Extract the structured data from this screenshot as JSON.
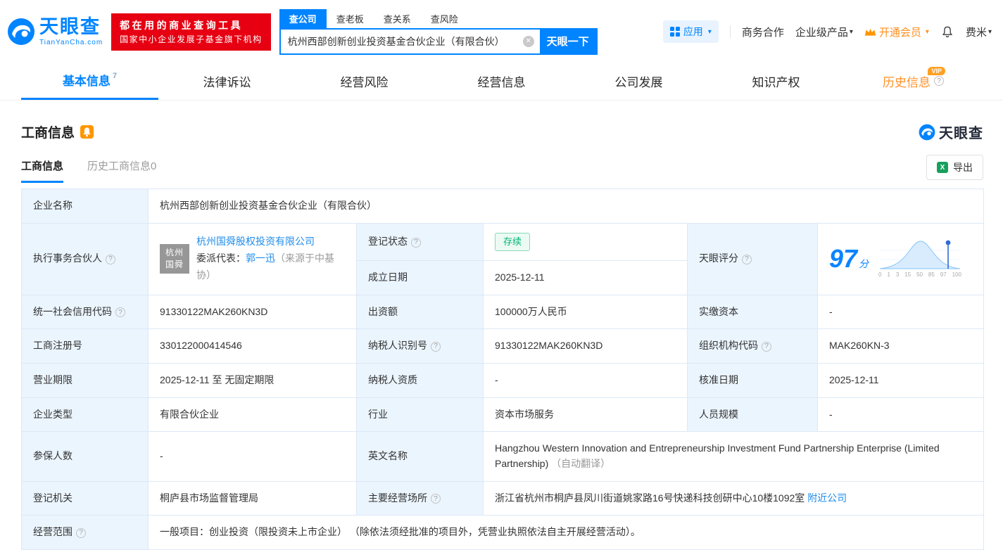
{
  "icons": {
    "caret": "▾",
    "help": "?",
    "clear": "✕",
    "excel": "X"
  },
  "header": {
    "logo_text": "天眼查",
    "logo_domain": "TianYanCha.com",
    "promo_line1": "都在用的商业查询工具",
    "promo_line2": "国家中小企业发展子基金旗下机构",
    "search_tabs": [
      {
        "label": "查公司"
      },
      {
        "label": "查老板"
      },
      {
        "label": "查关系"
      },
      {
        "label": "查风险"
      }
    ],
    "search_value": "杭州西部创新创业投资基金合伙企业（有限合伙）",
    "search_button": "天眼一下",
    "apps_label": "应用",
    "biz_coop": "商务合作",
    "enterprise_product": "企业级产品",
    "vip_label": "开通会员",
    "username": "费米"
  },
  "nav": {
    "tabs": [
      {
        "label": "基本信息",
        "count": "7"
      },
      {
        "label": "法律诉讼"
      },
      {
        "label": "经营风险"
      },
      {
        "label": "经营信息"
      },
      {
        "label": "公司发展"
      },
      {
        "label": "知识产权"
      },
      {
        "label": "历史信息",
        "vip": "VIP"
      }
    ]
  },
  "section": {
    "title": "工商信息",
    "watermark": "天眼查",
    "subtab_active": "工商信息",
    "subtab_history": "历史工商信息0",
    "export": "导出"
  },
  "table": {
    "company_name_label": "企业名称",
    "company_name": "杭州西部创新创业投资基金合伙企业（有限合伙）",
    "partner_label": "执行事务合伙人",
    "partner_logo": "杭州国舜",
    "partner_company": "杭州国舜股权投资有限公司",
    "delegate_prefix": "委派代表：",
    "delegate_name": "郭一迅",
    "delegate_source": "（来源于中基协）",
    "status_label": "登记状态",
    "status_value": "存续",
    "established_label": "成立日期",
    "established_value": "2025-12-11",
    "score_label": "天眼评分",
    "score_value": "97",
    "score_unit": "分",
    "score_axis": [
      "0",
      "1",
      "3",
      "15",
      "50",
      "85",
      "97",
      "100"
    ],
    "rows": [
      {
        "cells": [
          {
            "label": "统一社会信用代码",
            "value": "91330122MAK260KN3D"
          },
          {
            "label": "出资额",
            "value": "100000万人民币"
          },
          {
            "label": "实缴资本",
            "value": "-"
          }
        ]
      },
      {
        "cells": [
          {
            "label": "工商注册号",
            "value": "330122000414546"
          },
          {
            "label": "纳税人识别号",
            "value": "91330122MAK260KN3D"
          },
          {
            "label": "组织机构代码",
            "value": "MAK260KN-3"
          }
        ]
      },
      {
        "cells": [
          {
            "label": "营业期限",
            "value": "2025-12-11 至 无固定期限"
          },
          {
            "label": "纳税人资质",
            "value": "-"
          },
          {
            "label": "核准日期",
            "value": "2025-12-11"
          }
        ]
      },
      {
        "cells": [
          {
            "label": "企业类型",
            "value": "有限合伙企业"
          },
          {
            "label": "行业",
            "value": "资本市场服务"
          },
          {
            "label": "人员规模",
            "value": "-"
          }
        ]
      }
    ],
    "row7": {
      "label": "参保人数",
      "value": "-",
      "en_label": "英文名称",
      "en_value": "Hangzhou Western Innovation and Entrepreneurship Investment Fund Partnership Enterprise (Limited Partnership)",
      "en_note": "（自动翻译）"
    },
    "row8": {
      "label": "登记机关",
      "value": "桐庐县市场监督管理局",
      "addr_label": "主要经营场所",
      "addr_value": "浙江省杭州市桐庐县凤川街道姚家路16号快递科技创研中心10楼1092室",
      "nearby": "附近公司"
    },
    "row9": {
      "label": "经营范围",
      "value": "一般项目：创业投资（限投资未上市企业） （除依法须经批准的项目外，凭营业执照依法自主开展经营活动）。"
    }
  }
}
